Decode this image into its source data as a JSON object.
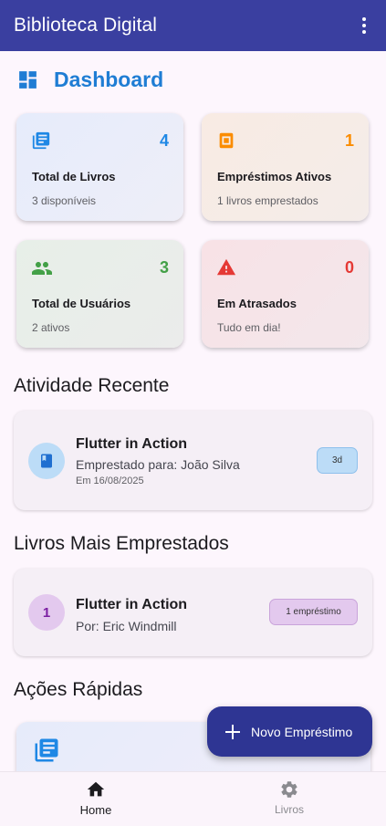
{
  "appbar": {
    "title": "Biblioteca Digital",
    "menu_icon": "more-vert-icon"
  },
  "dashboard": {
    "title": "Dashboard",
    "icon": "dashboard-icon"
  },
  "stats": [
    {
      "count": "4",
      "label": "Total de Livros",
      "sub": "3 disponíveis",
      "icon": "library-books-icon",
      "color": "#1f88e5",
      "bg": "#e8ecfa"
    },
    {
      "count": "1",
      "label": "Empréstimos Ativos",
      "sub": "1 livros emprestados",
      "icon": "book-loan-icon",
      "color": "#fb8c00",
      "bg": "#f6ebe6"
    },
    {
      "count": "3",
      "label": "Total de Usuários",
      "sub": "2 ativos",
      "icon": "people-icon",
      "color": "#43a047",
      "bg": "#e8ede8"
    },
    {
      "count": "0",
      "label": "Em Atrasados",
      "sub": "Tudo em dia!",
      "icon": "warning-icon",
      "color": "#e53935",
      "bg": "#f6e4e8"
    }
  ],
  "recent": {
    "title": "Atividade Recente",
    "item": {
      "title": "Flutter in Action",
      "sub": "Emprestado para: João Silva",
      "date": "Em 16/08/2025",
      "chip": "3d",
      "icon": "book-icon"
    }
  },
  "top_books": {
    "title": "Livros Mais Emprestados",
    "item": {
      "rank": "1",
      "title": "Flutter in Action",
      "sub": "Por: Eric Windmill",
      "chip": "1 empréstimo"
    }
  },
  "quick_actions": {
    "title": "Ações Rápidas"
  },
  "fab": {
    "label": "Novo Empréstimo",
    "icon": "add-icon"
  },
  "bottom_nav": [
    {
      "label": "Home",
      "icon": "home-icon",
      "active": true
    },
    {
      "label": "Livros",
      "icon": "gear-icon",
      "active": false
    }
  ]
}
